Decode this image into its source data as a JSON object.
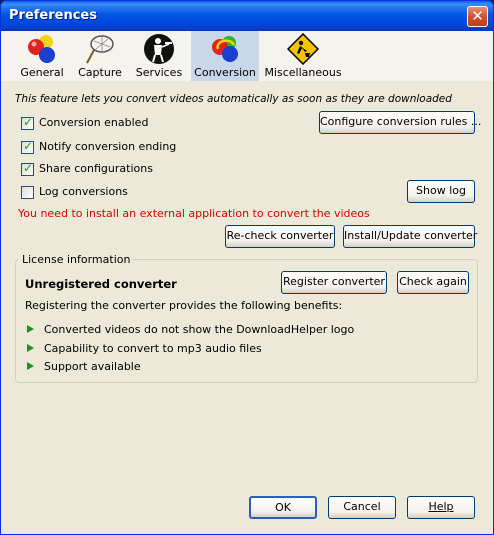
{
  "window": {
    "title": "Preferences"
  },
  "tabs": [
    {
      "label": "General",
      "icon": "balls-icon"
    },
    {
      "label": "Capture",
      "icon": "net-icon"
    },
    {
      "label": "Services",
      "icon": "waiter-icon"
    },
    {
      "label": "Conversion",
      "icon": "convert-balls-icon",
      "selected": true
    },
    {
      "label": "Miscellaneous",
      "icon": "roadwork-sign-icon"
    }
  ],
  "conversion": {
    "info_text": "This feature lets you convert videos automatically as soon as they are downloaded",
    "options": [
      {
        "label": "Conversion enabled",
        "checked": true
      },
      {
        "label": "Notify conversion ending",
        "checked": true
      },
      {
        "label": "Share configurations",
        "checked": true
      },
      {
        "label": "Log conversions",
        "checked": false
      }
    ],
    "configure_rules_label": "Configure conversion rules ...",
    "show_log_label": "Show log",
    "warning_text": "You need to install an external application to convert the videos",
    "recheck_label": "Re-check converter",
    "install_label": "Install/Update converter"
  },
  "license": {
    "group_title": "License information",
    "status": "Unregistered converter",
    "register_label": "Register converter",
    "check_again_label": "Check again",
    "benefits_intro": "Registering the converter provides the following benefits:",
    "benefits": [
      "Converted videos do not show the DownloadHelper logo",
      "Capability to convert to mp3 audio files",
      "Support available"
    ]
  },
  "footer": {
    "ok_label": "OK",
    "cancel_label": "Cancel",
    "help_label": "Help"
  },
  "colors": {
    "title_bar": "#0055e5",
    "warning": "#e00000",
    "bullet": "#1f8f1f",
    "selected_tab": "#c9d7ea"
  }
}
